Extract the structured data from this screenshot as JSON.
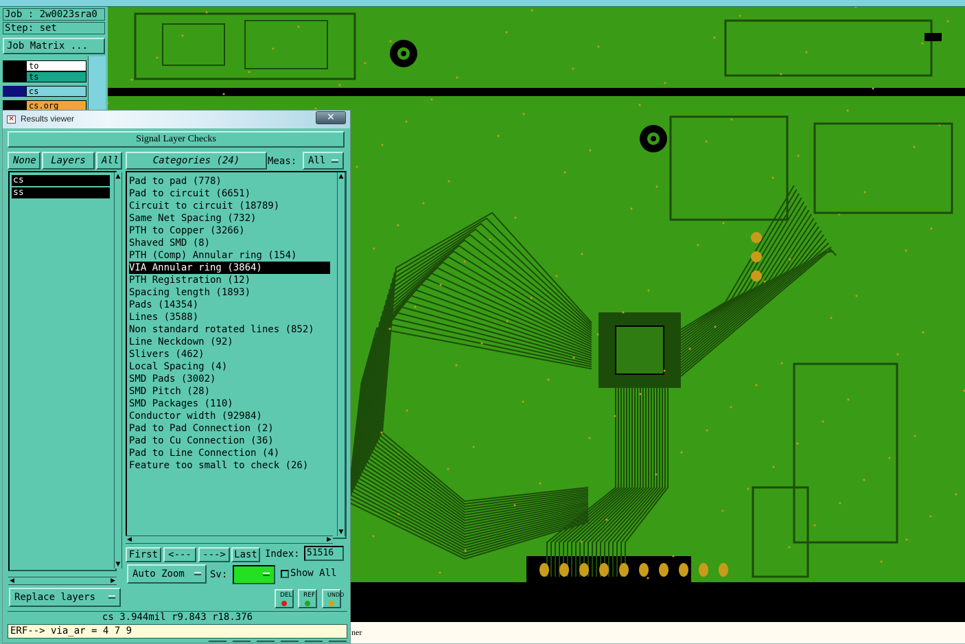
{
  "job": {
    "job_line": "Job : 2w0023sra0",
    "step_line": "Step: set",
    "job_matrix_label": "Job Matrix ..."
  },
  "layers_panel": {
    "items": [
      {
        "name": "to",
        "color": "#ffffff"
      },
      {
        "name": "ts",
        "color": "#17a689"
      },
      {
        "name": "cs",
        "color": "#7fd3dc"
      },
      {
        "name": "cs.org",
        "color": "#f2a33a"
      }
    ]
  },
  "results_viewer": {
    "window_title": "Results viewer",
    "close_glyph": "✕",
    "title_icon": "✕",
    "panel_title": "Signal Layer Checks",
    "none_label": "None",
    "layers_label": "Layers",
    "all_label": "All",
    "categories_label": "Categories (24)",
    "meas_label": "Meas:",
    "meas_value": "All",
    "layer_list": [
      "cs",
      "ss"
    ],
    "categories": [
      "Pad to pad (778)",
      "Pad to circuit (6651)",
      "Circuit to circuit (18789)",
      "Same Net Spacing (732)",
      "PTH to Copper (3266)",
      "Shaved SMD (8)",
      "PTH (Comp) Annular ring (154)",
      "VIA Annular ring (3864)",
      "PTH Registration (12)",
      "Spacing length (1893)",
      "Pads (14354)",
      "Lines (3588)",
      "Non standard rotated lines (852)",
      "Line Neckdown (92)",
      "Slivers (462)",
      "Local Spacing (4)",
      "SMD Pads (3002)",
      "SMD Pitch (28)",
      "SMD Packages (110)",
      "Conductor width (92984)",
      "Pad to Pad Connection (2)",
      "Pad to Cu Connection (36)",
      "Pad to Line Connection (4)",
      "Feature too small to check (26)"
    ],
    "selected_category_index": 7,
    "nav": {
      "first": "First",
      "prev": "<---",
      "next": "--->",
      "last": "Last",
      "index_label": "Index:",
      "index_value": "51516"
    },
    "auto_zoom_label": "Auto Zoom",
    "sv_label": "Sv:",
    "sv_color": "#23e021",
    "show_all_label": "Show All",
    "replace_layers_label": "Replace layers",
    "tools": [
      {
        "label": "DEL",
        "dot_color": "#d81e1e"
      },
      {
        "label": "REF",
        "dot_color": "#1ea81e"
      },
      {
        "label": "UNDO",
        "dot_color": "#e0a000"
      }
    ],
    "status_line": "cs 3.944mil   r9.843   r18.376",
    "erf_line": "ERF--> via_ar = 4 7 9"
  },
  "bottom_partial_text": "ner",
  "colors": {
    "panel_bg": "#5fc9b0",
    "pcb_green": "#3a9c16",
    "pcb_trace": "#1c4c0a",
    "pad_gold": "#c99b1a"
  }
}
